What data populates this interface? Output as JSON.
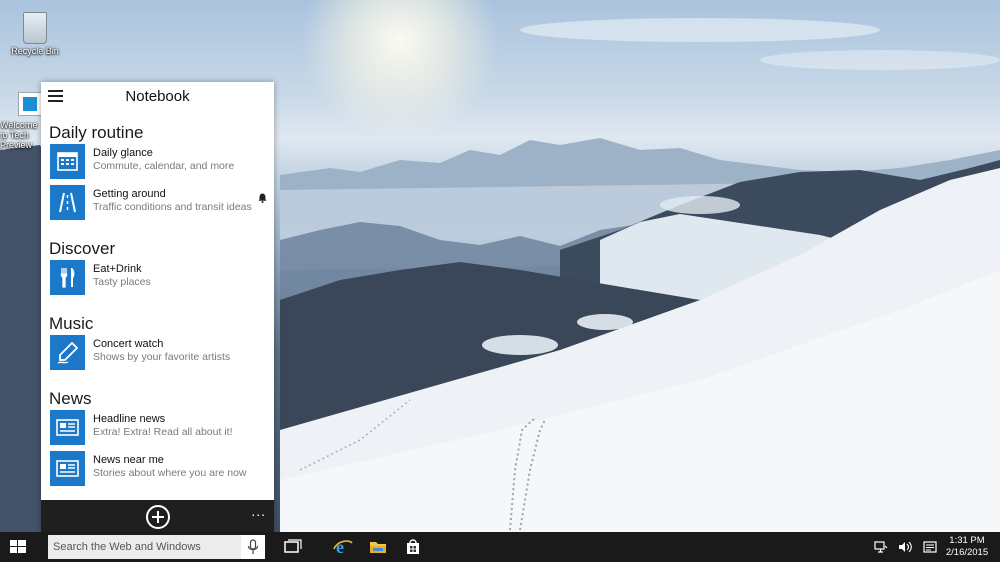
{
  "desktop": {
    "icons": [
      {
        "label": "Recycle Bin"
      },
      {
        "label": "Welcome to Tech Preview"
      }
    ]
  },
  "notebook": {
    "title": "Notebook",
    "sections": [
      {
        "title": "Daily routine",
        "items": [
          {
            "title": "Daily glance",
            "subtitle": "Commute, calendar, and more",
            "icon": "calendar-icon"
          },
          {
            "title": "Getting around",
            "subtitle": "Traffic conditions and transit ideas",
            "icon": "road-icon"
          }
        ]
      },
      {
        "title": "Discover",
        "items": [
          {
            "title": "Eat+Drink",
            "subtitle": "Tasty places",
            "icon": "fork-knife-icon"
          }
        ]
      },
      {
        "title": "Music",
        "items": [
          {
            "title": "Concert watch",
            "subtitle": "Shows by your favorite artists",
            "icon": "pen-icon"
          }
        ]
      },
      {
        "title": "News",
        "items": [
          {
            "title": "Headline news",
            "subtitle": "Extra! Extra! Read all about it!",
            "icon": "newspaper-icon"
          },
          {
            "title": "News near me",
            "subtitle": "Stories about where you are now",
            "icon": "newspaper-icon"
          }
        ]
      }
    ],
    "footer": {
      "more": "..."
    }
  },
  "taskbar": {
    "search_placeholder": "Search the Web and Windows",
    "clock": {
      "time": "1:31 PM",
      "date": "2/16/2015"
    }
  },
  "colors": {
    "tile_blue": "#1c78c9",
    "taskbar": "#1a1a1a",
    "panel_footer": "#1f1f1f"
  }
}
